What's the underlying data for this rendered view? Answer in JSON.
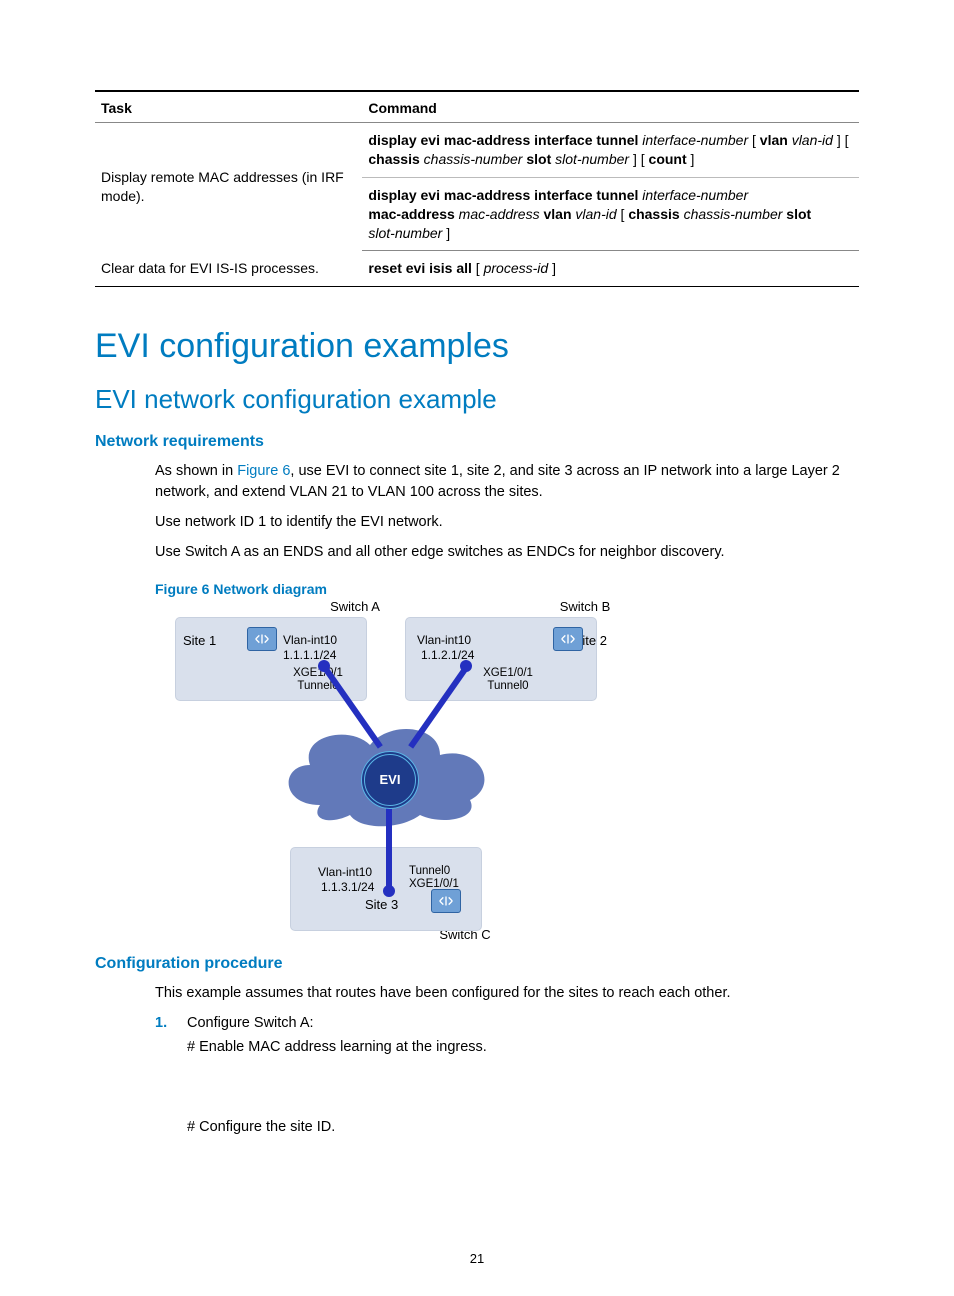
{
  "table": {
    "headers": {
      "task": "Task",
      "command": "Command"
    },
    "rows": [
      {
        "task": "Display remote MAC addresses (in IRF mode).",
        "cmd1": {
          "p1": "display evi mac-address interface tunnel ",
          "i1": "interface-number",
          "p2": " [ ",
          "b1": "vlan",
          "p3": " ",
          "i2": "vlan-id",
          "p4": " ] [ ",
          "b2": "chassis",
          "p5": " ",
          "i3": "chassis-number",
          "p6": " ",
          "b3": "slot",
          "p7": " ",
          "i4": "slot-number",
          "p8": " ] [ ",
          "b4": "count",
          "p9": " ]"
        },
        "cmd2": {
          "p1": "display evi mac-address interface tunnel ",
          "i1": "interface-number",
          "br": " ",
          "b1": "mac-address",
          "p2": " ",
          "i2": "mac-address",
          "p3": " ",
          "b2": "vlan",
          "p4": " ",
          "i3": "vlan-id",
          "p5": " [ ",
          "b3": "chassis",
          "p6": " ",
          "i4": "chassis-number",
          "p7": " ",
          "b4": "slot",
          "p8": " ",
          "i5": "slot-number",
          "p9": " ]"
        }
      },
      {
        "task": "Clear data for EVI IS-IS processes.",
        "cmd": {
          "p1": "reset evi isis all",
          "p2": " [ ",
          "i1": "process-id",
          "p3": " ]"
        }
      }
    ]
  },
  "h1": "EVI configuration examples",
  "h2": "EVI network configuration example",
  "req": "Network requirements",
  "p1a": "As shown in ",
  "p1link": "Figure 6",
  "p1b": ", use EVI to connect site 1, site 2, and site 3 across an IP network into a large Layer 2 network, and extend VLAN 21 to VLAN 100 across the sites.",
  "p2": "Use network ID 1 to identify the EVI network.",
  "p3": "Use Switch A as an ENDS and all other edge switches as ENDCs for neighbor discovery.",
  "figTitle": "Figure 6 Network diagram",
  "diagram": {
    "switchA": "Switch A",
    "switchB": "Switch B",
    "switchC": "Switch C",
    "site1": "Site 1",
    "site2": "Site 2",
    "site3": "Site 3",
    "vlanInt": "Vlan-int10",
    "ipA": "1.1.1.1/24",
    "ipB": "1.1.2.1/24",
    "ipC": "1.1.3.1/24",
    "xge": "XGE1/0/1",
    "tunnel": "Tunnel0",
    "evi": "EVI"
  },
  "confProc": "Configuration procedure",
  "p4": "This example assumes that routes have been configured for the sites to reach each other.",
  "step1num": "1.",
  "step1": "Configure Switch A:",
  "step1a": "# Enable MAC address learning at the ingress.",
  "step1b": "# Configure the site ID.",
  "pageNum": "21"
}
